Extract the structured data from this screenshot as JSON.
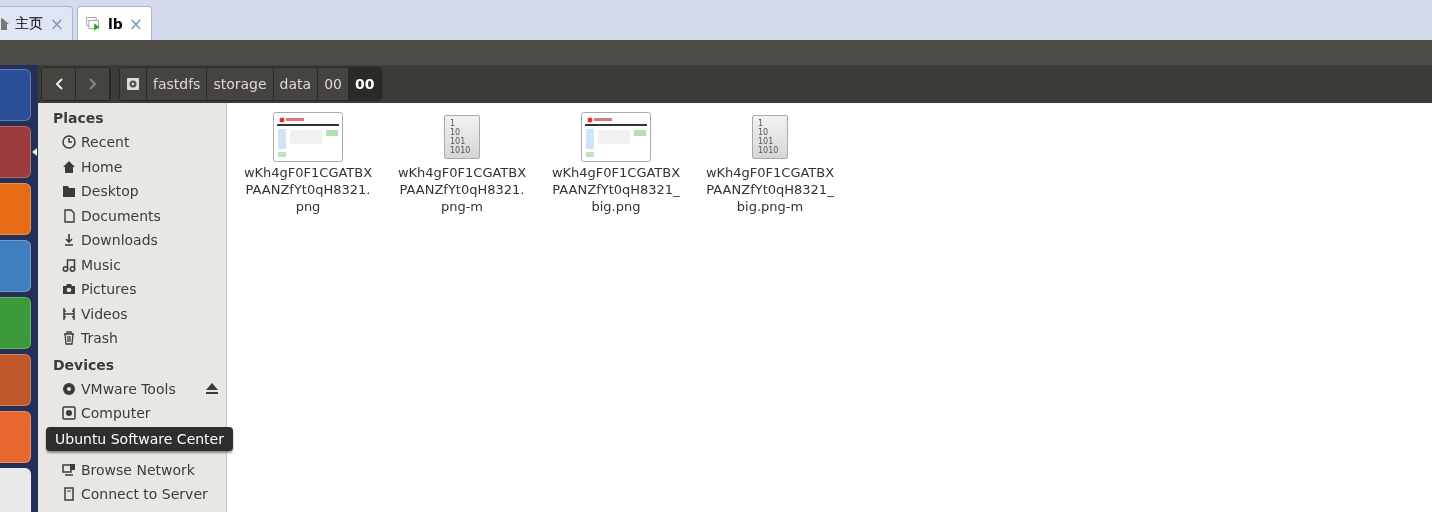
{
  "browser_tabs": [
    {
      "label": "主页",
      "kind": "home",
      "selected": false,
      "close": "×"
    },
    {
      "label": "lb",
      "kind": "vm",
      "selected": true,
      "close": "×"
    }
  ],
  "toolbar": {
    "path": [
      {
        "label": "fastdfs",
        "selected": false
      },
      {
        "label": "storage",
        "selected": false
      },
      {
        "label": "data",
        "selected": false
      },
      {
        "label": "00",
        "selected": false
      },
      {
        "label": "00",
        "selected": true
      }
    ]
  },
  "launcher": {
    "items": [
      {
        "kind": "ubuntu",
        "running": false
      },
      {
        "kind": "files",
        "running": true
      },
      {
        "kind": "firefox",
        "running": false
      },
      {
        "kind": "writer",
        "running": false
      },
      {
        "kind": "calc",
        "running": false
      },
      {
        "kind": "impress",
        "running": false
      },
      {
        "kind": "software",
        "running": false
      },
      {
        "kind": "amazon",
        "running": false
      }
    ],
    "tooltip": "Ubuntu Software Center"
  },
  "sidebar": {
    "sections": [
      {
        "title": "Places",
        "items": [
          {
            "label": "Recent",
            "kind": "clock"
          },
          {
            "label": "Home",
            "kind": "home"
          },
          {
            "label": "Desktop",
            "kind": "folder"
          },
          {
            "label": "Documents",
            "kind": "doc"
          },
          {
            "label": "Downloads",
            "kind": "download"
          },
          {
            "label": "Music",
            "kind": "music"
          },
          {
            "label": "Pictures",
            "kind": "camera"
          },
          {
            "label": "Videos",
            "kind": "film"
          },
          {
            "label": "Trash",
            "kind": "trash"
          }
        ]
      },
      {
        "title": "Devices",
        "items": [
          {
            "label": "VMware Tools",
            "kind": "disc",
            "eject": true
          },
          {
            "label": "Computer",
            "kind": "drive",
            "eject": false
          }
        ]
      },
      {
        "items": [
          {
            "label": "Browse Network",
            "kind": "network"
          },
          {
            "label": "Connect to Server",
            "kind": "server"
          }
        ]
      }
    ]
  },
  "files": [
    {
      "name": "wKh4gF0F1CGATBX PAANZfYt0qH8321. png",
      "kind": "image"
    },
    {
      "name": "wKh4gF0F1CGATBX PAANZfYt0qH8321. png-m",
      "kind": "binary",
      "icon_lines": [
        "1",
        "10",
        "101",
        "1010"
      ]
    },
    {
      "name": "wKh4gF0F1CGATBX PAANZfYt0qH8321_ big.png",
      "kind": "image"
    },
    {
      "name": "wKh4gF0F1CGATBX PAANZfYt0qH8321_ big.png-m",
      "kind": "binary",
      "icon_lines": [
        "1",
        "10",
        "101",
        "1010"
      ]
    }
  ]
}
